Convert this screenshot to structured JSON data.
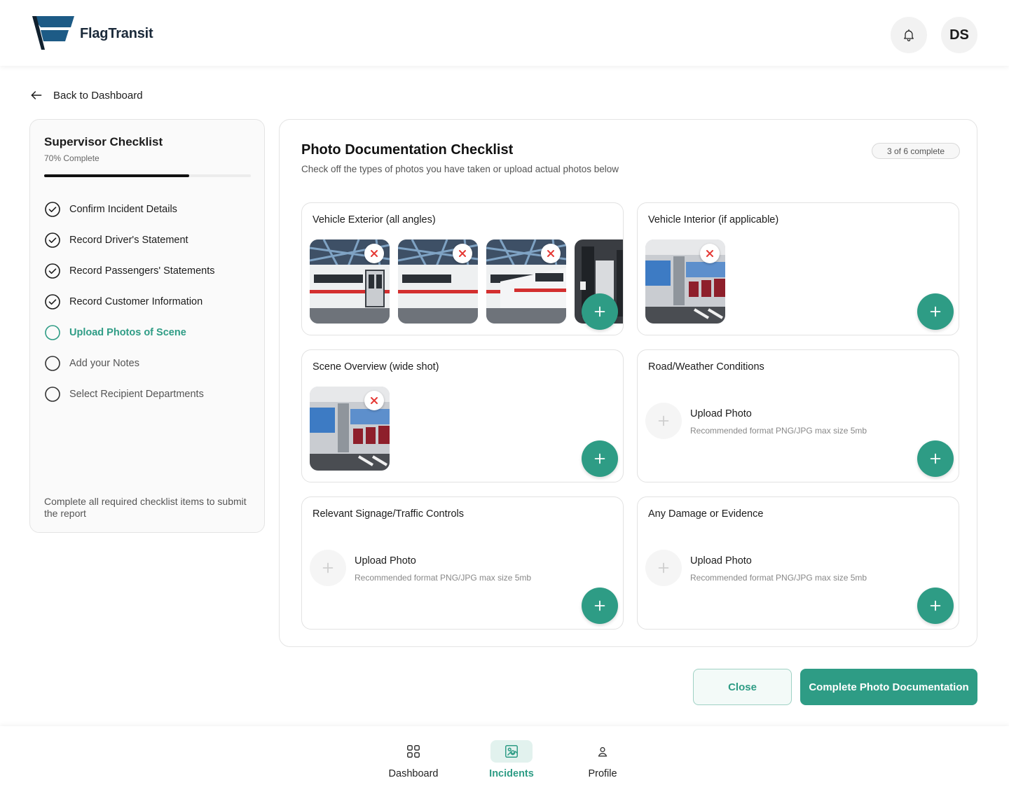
{
  "app": {
    "name": "FlagTransit",
    "avatar_initials": "DS"
  },
  "colors": {
    "accent": "#2e9c85",
    "accent_light": "#e2f2ee",
    "remove": "#e53935",
    "text": "#1c1c1c"
  },
  "back": {
    "label": "Back to Dashboard"
  },
  "sidebar": {
    "title": "Supervisor Checklist",
    "progress_text": "70% Complete",
    "progress": 0.7,
    "items": [
      {
        "label": "Confirm Incident Details",
        "state": "done"
      },
      {
        "label": "Record Driver's Statement",
        "state": "done"
      },
      {
        "label": "Record Passengers' Statements",
        "state": "done"
      },
      {
        "label": "Record Customer Information",
        "state": "done"
      },
      {
        "label": "Upload Photos of Scene",
        "state": "active"
      },
      {
        "label": "Add your Notes",
        "state": "todo"
      },
      {
        "label": "Select Recipient Departments",
        "state": "todo"
      }
    ],
    "footer_note": "Complete all required checklist items to submit the report"
  },
  "main": {
    "title": "Photo Documentation Checklist",
    "subtitle": "Check off the types of photos you have taken or upload actual photos below",
    "badge": "3 of 6 complete",
    "cards": [
      {
        "title": "Vehicle Exterior (all angles)",
        "photos": [
          "train-exterior-1",
          "train-exterior-2",
          "train-exterior-3",
          "train-equipment"
        ]
      },
      {
        "title": "Vehicle Interior (if applicable)",
        "photos": [
          "train-interior"
        ]
      },
      {
        "title": "Scene Overview (wide shot)",
        "photos": [
          "train-interior"
        ]
      },
      {
        "title": "Road/Weather Conditions",
        "photos": [],
        "upload_title": "Upload Photo",
        "upload_hint": "Recommended format PNG/JPG max size 5mb"
      },
      {
        "title": "Relevant Signage/Traffic Controls",
        "photos": [],
        "upload_title": "Upload Photo",
        "upload_hint": "Recommended format PNG/JPG max size 5mb"
      },
      {
        "title": "Any Damage or Evidence",
        "photos": [],
        "upload_title": "Upload Photo",
        "upload_hint": "Recommended format PNG/JPG max size 5mb"
      }
    ]
  },
  "actions": {
    "close": "Close",
    "complete": "Complete Photo Documentation"
  },
  "nav": {
    "items": [
      {
        "label": "Dashboard",
        "icon": "grid-icon",
        "active": false
      },
      {
        "label": "Incidents",
        "icon": "image-icon",
        "active": true
      },
      {
        "label": "Profile",
        "icon": "user-icon",
        "active": false
      }
    ]
  }
}
